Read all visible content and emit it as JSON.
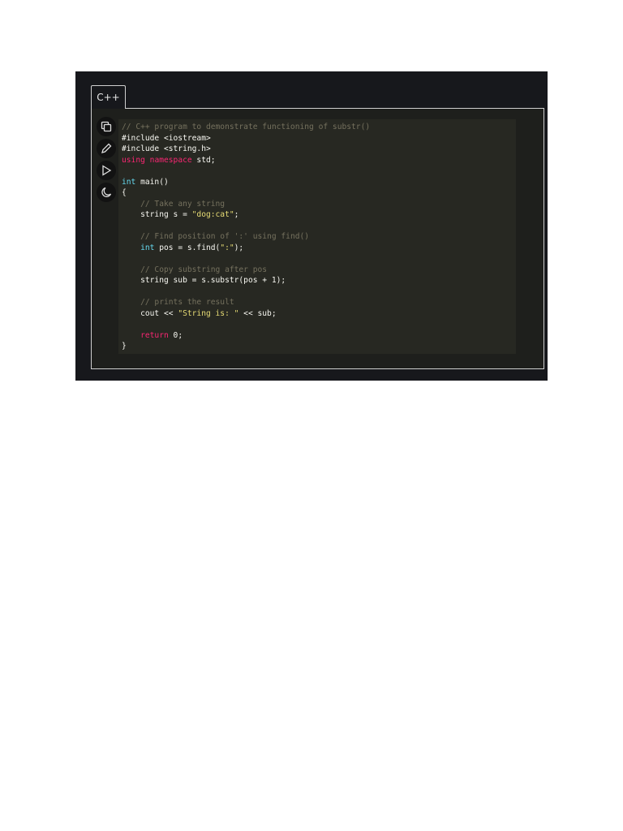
{
  "tab": {
    "label": "C++"
  },
  "toolbar": [
    "copy-icon",
    "edit-icon",
    "run-icon",
    "dark-mode-icon"
  ],
  "code": [
    [
      [
        "c",
        "// C++ program to demonstrate functioning of substr()"
      ]
    ],
    [
      [
        "p",
        "#include <iostream>"
      ]
    ],
    [
      [
        "p",
        "#include <string.h>"
      ]
    ],
    [
      [
        "k",
        "using"
      ],
      [
        "p",
        " "
      ],
      [
        "k",
        "namespace"
      ],
      [
        "p",
        " std;"
      ]
    ],
    [],
    [
      [
        "t",
        "int"
      ],
      [
        "p",
        " main()"
      ]
    ],
    [
      [
        "p",
        "{"
      ]
    ],
    [
      [
        "p",
        "    "
      ],
      [
        "c",
        "// Take any string"
      ]
    ],
    [
      [
        "p",
        "    string s = "
      ],
      [
        "s",
        "\"dog:cat\""
      ],
      [
        "p",
        ";"
      ]
    ],
    [],
    [
      [
        "p",
        "    "
      ],
      [
        "c",
        "// Find position of ':' using find()"
      ]
    ],
    [
      [
        "p",
        "    "
      ],
      [
        "t",
        "int"
      ],
      [
        "p",
        " pos = s.find("
      ],
      [
        "s",
        "\":\""
      ],
      [
        "p",
        ");"
      ]
    ],
    [],
    [
      [
        "p",
        "    "
      ],
      [
        "c",
        "// Copy substring after pos"
      ]
    ],
    [
      [
        "p",
        "    string sub = s.substr(pos + 1);"
      ]
    ],
    [],
    [
      [
        "p",
        "    "
      ],
      [
        "c",
        "// prints the result"
      ]
    ],
    [
      [
        "p",
        "    cout << "
      ],
      [
        "s",
        "\"String is: \""
      ],
      [
        "p",
        " << sub;"
      ]
    ],
    [],
    [
      [
        "p",
        "    "
      ],
      [
        "k",
        "return"
      ],
      [
        "p",
        " 0;"
      ]
    ],
    [
      [
        "p",
        "}"
      ]
    ]
  ]
}
